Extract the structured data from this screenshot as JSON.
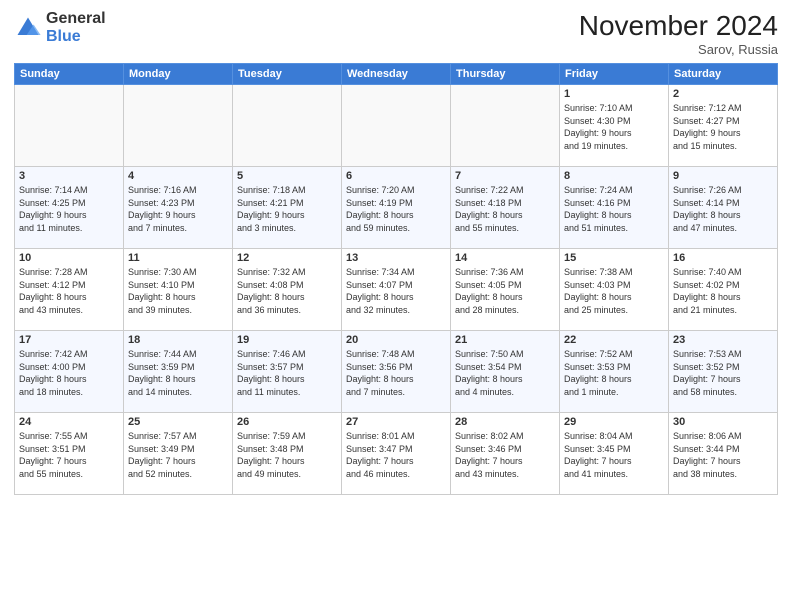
{
  "logo": {
    "general": "General",
    "blue": "Blue"
  },
  "title": "November 2024",
  "location": "Sarov, Russia",
  "days_of_week": [
    "Sunday",
    "Monday",
    "Tuesday",
    "Wednesday",
    "Thursday",
    "Friday",
    "Saturday"
  ],
  "weeks": [
    [
      {
        "day": "",
        "info": ""
      },
      {
        "day": "",
        "info": ""
      },
      {
        "day": "",
        "info": ""
      },
      {
        "day": "",
        "info": ""
      },
      {
        "day": "",
        "info": ""
      },
      {
        "day": "1",
        "info": "Sunrise: 7:10 AM\nSunset: 4:30 PM\nDaylight: 9 hours\nand 19 minutes."
      },
      {
        "day": "2",
        "info": "Sunrise: 7:12 AM\nSunset: 4:27 PM\nDaylight: 9 hours\nand 15 minutes."
      }
    ],
    [
      {
        "day": "3",
        "info": "Sunrise: 7:14 AM\nSunset: 4:25 PM\nDaylight: 9 hours\nand 11 minutes."
      },
      {
        "day": "4",
        "info": "Sunrise: 7:16 AM\nSunset: 4:23 PM\nDaylight: 9 hours\nand 7 minutes."
      },
      {
        "day": "5",
        "info": "Sunrise: 7:18 AM\nSunset: 4:21 PM\nDaylight: 9 hours\nand 3 minutes."
      },
      {
        "day": "6",
        "info": "Sunrise: 7:20 AM\nSunset: 4:19 PM\nDaylight: 8 hours\nand 59 minutes."
      },
      {
        "day": "7",
        "info": "Sunrise: 7:22 AM\nSunset: 4:18 PM\nDaylight: 8 hours\nand 55 minutes."
      },
      {
        "day": "8",
        "info": "Sunrise: 7:24 AM\nSunset: 4:16 PM\nDaylight: 8 hours\nand 51 minutes."
      },
      {
        "day": "9",
        "info": "Sunrise: 7:26 AM\nSunset: 4:14 PM\nDaylight: 8 hours\nand 47 minutes."
      }
    ],
    [
      {
        "day": "10",
        "info": "Sunrise: 7:28 AM\nSunset: 4:12 PM\nDaylight: 8 hours\nand 43 minutes."
      },
      {
        "day": "11",
        "info": "Sunrise: 7:30 AM\nSunset: 4:10 PM\nDaylight: 8 hours\nand 39 minutes."
      },
      {
        "day": "12",
        "info": "Sunrise: 7:32 AM\nSunset: 4:08 PM\nDaylight: 8 hours\nand 36 minutes."
      },
      {
        "day": "13",
        "info": "Sunrise: 7:34 AM\nSunset: 4:07 PM\nDaylight: 8 hours\nand 32 minutes."
      },
      {
        "day": "14",
        "info": "Sunrise: 7:36 AM\nSunset: 4:05 PM\nDaylight: 8 hours\nand 28 minutes."
      },
      {
        "day": "15",
        "info": "Sunrise: 7:38 AM\nSunset: 4:03 PM\nDaylight: 8 hours\nand 25 minutes."
      },
      {
        "day": "16",
        "info": "Sunrise: 7:40 AM\nSunset: 4:02 PM\nDaylight: 8 hours\nand 21 minutes."
      }
    ],
    [
      {
        "day": "17",
        "info": "Sunrise: 7:42 AM\nSunset: 4:00 PM\nDaylight: 8 hours\nand 18 minutes."
      },
      {
        "day": "18",
        "info": "Sunrise: 7:44 AM\nSunset: 3:59 PM\nDaylight: 8 hours\nand 14 minutes."
      },
      {
        "day": "19",
        "info": "Sunrise: 7:46 AM\nSunset: 3:57 PM\nDaylight: 8 hours\nand 11 minutes."
      },
      {
        "day": "20",
        "info": "Sunrise: 7:48 AM\nSunset: 3:56 PM\nDaylight: 8 hours\nand 7 minutes."
      },
      {
        "day": "21",
        "info": "Sunrise: 7:50 AM\nSunset: 3:54 PM\nDaylight: 8 hours\nand 4 minutes."
      },
      {
        "day": "22",
        "info": "Sunrise: 7:52 AM\nSunset: 3:53 PM\nDaylight: 8 hours\nand 1 minute."
      },
      {
        "day": "23",
        "info": "Sunrise: 7:53 AM\nSunset: 3:52 PM\nDaylight: 7 hours\nand 58 minutes."
      }
    ],
    [
      {
        "day": "24",
        "info": "Sunrise: 7:55 AM\nSunset: 3:51 PM\nDaylight: 7 hours\nand 55 minutes."
      },
      {
        "day": "25",
        "info": "Sunrise: 7:57 AM\nSunset: 3:49 PM\nDaylight: 7 hours\nand 52 minutes."
      },
      {
        "day": "26",
        "info": "Sunrise: 7:59 AM\nSunset: 3:48 PM\nDaylight: 7 hours\nand 49 minutes."
      },
      {
        "day": "27",
        "info": "Sunrise: 8:01 AM\nSunset: 3:47 PM\nDaylight: 7 hours\nand 46 minutes."
      },
      {
        "day": "28",
        "info": "Sunrise: 8:02 AM\nSunset: 3:46 PM\nDaylight: 7 hours\nand 43 minutes."
      },
      {
        "day": "29",
        "info": "Sunrise: 8:04 AM\nSunset: 3:45 PM\nDaylight: 7 hours\nand 41 minutes."
      },
      {
        "day": "30",
        "info": "Sunrise: 8:06 AM\nSunset: 3:44 PM\nDaylight: 7 hours\nand 38 minutes."
      }
    ]
  ]
}
